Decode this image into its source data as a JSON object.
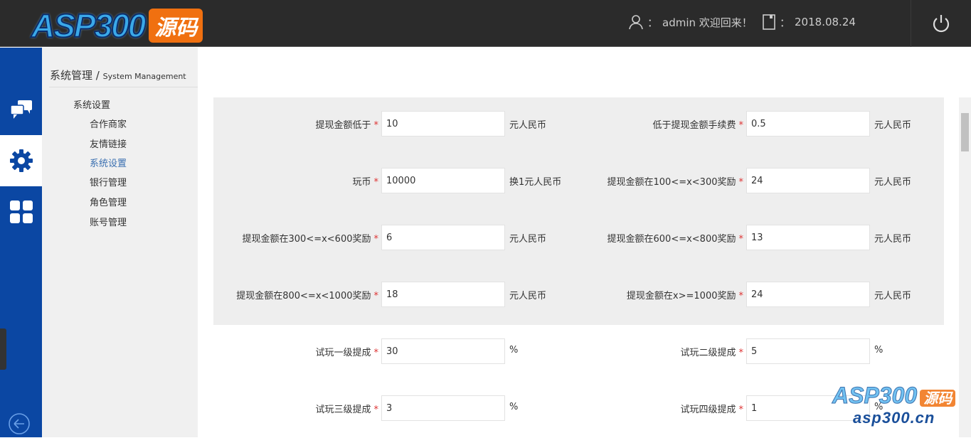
{
  "header": {
    "logo_text": "ASP300",
    "logo_badge": "源码",
    "user_sep": "：",
    "user_text": "admin 欢迎回来！",
    "date_sep": "：",
    "date": "2018.08.24",
    "icons": [
      "user-icon",
      "calendar-icon",
      "power-icon"
    ]
  },
  "rail": {
    "icons": [
      "chat-icon",
      "gear-icon",
      "grid-icon",
      "back-arrow-icon"
    ],
    "active": "gear-icon",
    "colors": {
      "rail": "#0b47a3",
      "active": "#ffffff"
    }
  },
  "sidebar": {
    "crumb_main": "系统管理",
    "crumb_sep": "/",
    "crumb_sub": "System Management",
    "group": "系统设置",
    "items": [
      {
        "label": "合作商家"
      },
      {
        "label": "友情链接"
      },
      {
        "label": "系统设置",
        "active": true
      },
      {
        "label": "银行管理"
      },
      {
        "label": "角色管理"
      },
      {
        "label": "账号管理"
      }
    ]
  },
  "form": {
    "required_mark": "*",
    "rows": [
      [
        {
          "label": "提现金额低于",
          "value": "10",
          "unit": "元人民币"
        },
        {
          "label": "低于提现金额手续费",
          "value": "0.5",
          "unit": "元人民币"
        }
      ],
      [
        {
          "label": "玩币",
          "value": "10000",
          "unit": "换1元人民币"
        },
        {
          "label": "提现金额在100<=x<300奖励",
          "value": "24",
          "unit": "元人民币"
        }
      ],
      [
        {
          "label": "提现金额在300<=x<600奖励",
          "value": "6",
          "unit": "元人民币"
        },
        {
          "label": "提现金额在600<=x<800奖励",
          "value": "13",
          "unit": "元人民币"
        }
      ],
      [
        {
          "label": "提现金额在800<=x<1000奖励",
          "value": "18",
          "unit": "元人民币"
        },
        {
          "label": "提现金额在x>=1000奖励",
          "value": "24",
          "unit": "元人民币"
        }
      ],
      [
        {
          "label": "试玩一级提成",
          "value": "30",
          "unit": "%"
        },
        {
          "label": "试玩二级提成",
          "value": "5",
          "unit": "%"
        }
      ],
      [
        {
          "label": "试玩三级提成",
          "value": "3",
          "unit": "%"
        },
        {
          "label": "试玩四级提成",
          "value": "1",
          "unit": "%"
        }
      ]
    ]
  },
  "watermark": {
    "logo": "ASP300",
    "badge": "源码",
    "url": "asp300.cn"
  }
}
